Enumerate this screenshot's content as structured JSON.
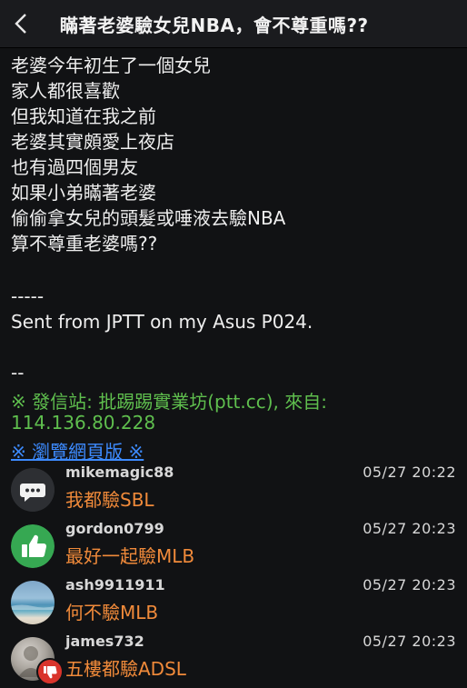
{
  "header": {
    "title": "瞞著老婆驗女兒NBA，會不尊重嗎??"
  },
  "post": {
    "lines": [
      "老婆今年初生了一個女兒",
      "家人都很喜歡",
      "但我知道在我之前",
      "老婆其實頗愛上夜店",
      "也有過四個男友",
      "如果小弟瞞著老婆",
      "偷偷拿女兒的頭髮或唾液去驗NBA",
      "算不尊重老婆嗎??"
    ],
    "divider": "-----",
    "sent_from": "Sent from JPTT on my Asus P024.",
    "sig_dashes": "--",
    "source_line1": "※ 發信站: 批踢踢實業坊(ptt.cc), 來自:",
    "source_line2": "114.136.80.228",
    "web_link": "※ 瀏覽網頁版 ※"
  },
  "comments": [
    {
      "user": "mikemagic88",
      "time": "05/27 20:22",
      "text": "我都驗SBL",
      "avatar": "speech-bubble"
    },
    {
      "user": "gordon0799",
      "time": "05/27 20:23",
      "text": "最好一起驗MLB",
      "avatar": "thumbs-up"
    },
    {
      "user": "ash9911911",
      "time": "05/27 20:23",
      "text": "何不驗MLB",
      "avatar": "beach-photo"
    },
    {
      "user": "james732",
      "time": "05/27 20:23",
      "text": "五樓都驗ADSL",
      "avatar": "profile-photo-thumbs-down"
    }
  ],
  "colors": {
    "background": "#111214",
    "comment_text": "#f08a3a",
    "ip_green": "#5fbf4e",
    "link_blue": "#3d8bff",
    "push_green": "#36a852",
    "boo_red": "#d9342b"
  }
}
